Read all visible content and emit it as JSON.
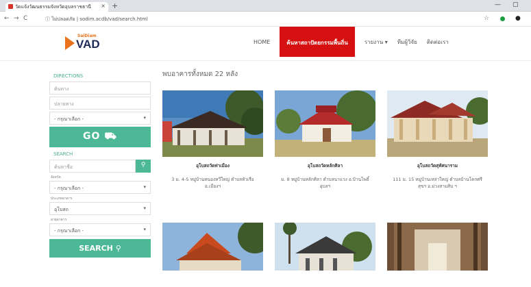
{
  "browser": {
    "tab_title": "วัดแจ้งวัฒนธรรมจังหวัดอุบลราชธานี",
    "address": "ไม่ปลอดภัย | sodim.acdb/vad/search.html"
  },
  "header": {
    "logo_top": "SaiDiam",
    "logo_main": "VAD",
    "menu": [
      {
        "label": "HOME",
        "active": false
      },
      {
        "label": "ค้นหาสถาปัตยกรรมพื้นถิ่น",
        "active": true
      },
      {
        "label": "รายงาน ▾",
        "active": false
      },
      {
        "label": "ทีมผู้วิจัย",
        "active": false
      },
      {
        "label": "ติดต่อเรา",
        "active": false
      }
    ]
  },
  "sidebar": {
    "directions_label": "DIRECTIONS",
    "origin_placeholder": "ต้นทาง",
    "destination_placeholder": "ปลายทาง",
    "select_placeholder": "- กรุณาเลือก -",
    "go_label": "GO",
    "go_icon": "car-icon",
    "search_label": "SEARCH",
    "keyword_placeholder": "ค้นหาชื่อ",
    "search_icon": "search-icon",
    "province_label": "จังหวัด",
    "province_value": "- กรุณาเลือก -",
    "type_label": "ประเภทอาคาร",
    "type_value": "อุโบสถ",
    "age_label": "อายุอาคาร",
    "age_value": "- กรุณาเลือก -",
    "search_button": "SEARCH"
  },
  "main": {
    "count_text": "พบอาคารทั้งหมด 22 หลัง",
    "cards": [
      {
        "title": "อุโบสถวัดท่าเมือง",
        "address": "3 ม. 4-5 หมู่บ้านหนองหวีใหญ่ ตำบลหัวเรือ อ.เมืองฯ"
      },
      {
        "title": "อุโบสถวัดหลักศิลา",
        "address": "ม. 8 หมู่บ้านหลักศิลา ตำบลนาแวง อ.บ้านโพธิ์อุบลฯ"
      },
      {
        "title": "อุโบสถวัดสุทัศนาราม",
        "address": "111 ม. 15 หมู่บ้านเหล่าใหญ่ ตำบลบ้านโคกศรีสุขฯ อ.ม่วงสามสิบ ฯ"
      },
      {
        "title": "",
        "address": ""
      },
      {
        "title": "",
        "address": ""
      },
      {
        "title": "",
        "address": ""
      }
    ]
  },
  "colors": {
    "accent": "#4db896",
    "active_menu": "#d61010",
    "brand": "#1d2a57"
  }
}
